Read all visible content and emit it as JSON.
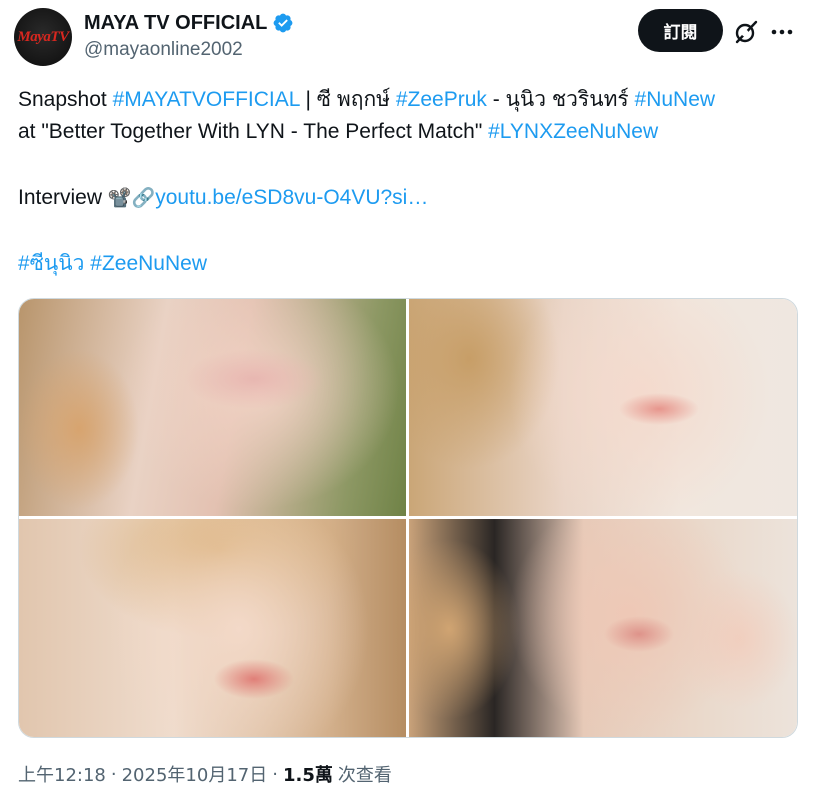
{
  "author": {
    "display_name": "MAYA TV OFFICIAL",
    "handle": "@mayaonline2002",
    "avatar_text": "MayaTV",
    "verified_color": "#1d9bf0"
  },
  "header": {
    "subscribe_label": "訂閱",
    "grok_icon": "grok-icon",
    "more_icon": "more-icon"
  },
  "text": {
    "line1": {
      "t1": "Snapshot ",
      "link1": "#MAYATVOFFICIAL",
      "t2": " | ซี พฤกษ์ ",
      "link2": "#ZeePruk",
      "t3": " - นุนิว ชวรินทร์ ",
      "link3": "#NuNew"
    },
    "line2": {
      "t1": "at \"Better Together With LYN - The Perfect Match\" ",
      "link1": "#LYNXZeeNuNew"
    },
    "line3": {
      "t1": "Interview ",
      "emoji1": "📽️",
      "emoji2": "🔗",
      "link1": "youtu.be/eSD8vu-O4VU?si…"
    },
    "line4": {
      "link1": "#ซีนุนิว",
      "t1": " ",
      "link2": "#ZeeNuNew"
    }
  },
  "footer": {
    "time": "上午12:18",
    "separator": "·",
    "date": "2025年10月17日",
    "views_count": "1.5萬",
    "views_label": "次查看"
  },
  "colors": {
    "link": "#1d9bf0",
    "text": "#0f1419",
    "muted": "#536471",
    "button_bg": "#0f1419"
  }
}
